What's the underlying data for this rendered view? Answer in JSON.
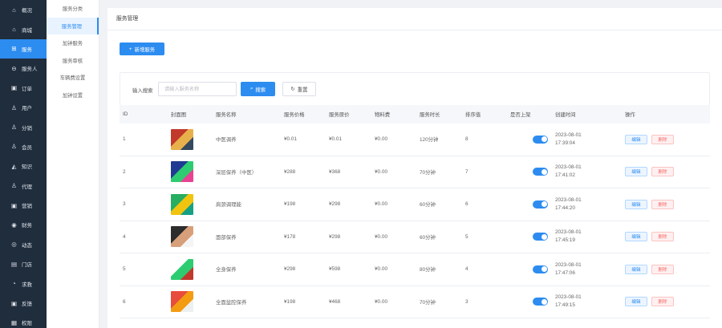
{
  "nav": {
    "items": [
      {
        "icon": "home-icon",
        "glyph": "⌂",
        "label": "概况"
      },
      {
        "icon": "shop-icon",
        "glyph": "⌂",
        "label": "商城"
      },
      {
        "icon": "service-icon",
        "glyph": "⊞",
        "label": "服务"
      },
      {
        "icon": "car-icon",
        "glyph": "⊖",
        "label": "服务人"
      },
      {
        "icon": "order-icon",
        "glyph": "▣",
        "label": "订单"
      },
      {
        "icon": "user-icon",
        "glyph": "♙",
        "label": "用户"
      },
      {
        "icon": "distribution-icon",
        "glyph": "♙",
        "label": "分销"
      },
      {
        "icon": "member-icon",
        "glyph": "♙",
        "label": "会员"
      },
      {
        "icon": "knowledge-icon",
        "glyph": "◭",
        "label": "知识"
      },
      {
        "icon": "agent-icon",
        "glyph": "♙",
        "label": "代理"
      },
      {
        "icon": "marketing-icon",
        "glyph": "▣",
        "label": "营销"
      },
      {
        "icon": "finance-icon",
        "glyph": "◉",
        "label": "财务"
      },
      {
        "icon": "activity-icon",
        "glyph": "◎",
        "label": "动态"
      },
      {
        "icon": "store-icon",
        "glyph": "▤",
        "label": "门店"
      },
      {
        "icon": "help-icon",
        "glyph": "◔",
        "label": "求救"
      },
      {
        "icon": "feedback-icon",
        "glyph": "▣",
        "label": "反馈"
      },
      {
        "icon": "permission-icon",
        "glyph": "▦",
        "label": "权限"
      }
    ],
    "active_index": 2
  },
  "subnav": {
    "items": [
      "服务分类",
      "服务管理",
      "加钟服务",
      "服务审核",
      "车辆费设置",
      "加钟设置"
    ],
    "active_index": 1
  },
  "page": {
    "title": "服务管理",
    "add_button": "新增服务"
  },
  "filter": {
    "label": "输入搜索",
    "placeholder": "请输入服务名称",
    "search_button": "搜索",
    "reset_button": "重置"
  },
  "table": {
    "columns": [
      "ID",
      "封面图",
      "服务名称",
      "服务价格",
      "服务原价",
      "物料费",
      "服务时长",
      "排序值",
      "是否上架",
      "创建时间",
      "操作"
    ],
    "edit_label": "编辑",
    "delete_label": "删除",
    "rows": [
      {
        "id": "1",
        "name": "中医调养",
        "price": "¥0.01",
        "orig": "¥0.01",
        "fee": "¥0.00",
        "duration": "120分钟",
        "sort": "8",
        "date": "2023-08-01",
        "time": "17:39:04",
        "colors": [
          "#c0392b",
          "#e8b04b",
          "#34495e"
        ]
      },
      {
        "id": "2",
        "name": "深层保养（中医）",
        "price": "¥288",
        "orig": "¥368",
        "fee": "¥0.00",
        "duration": "70分钟",
        "sort": "7",
        "date": "2023-08-01",
        "time": "17:41:02",
        "colors": [
          "#1f3a93",
          "#2ecc71",
          "#e84393"
        ]
      },
      {
        "id": "3",
        "name": "肩颈调理能",
        "price": "¥198",
        "orig": "¥298",
        "fee": "¥0.00",
        "duration": "60分钟",
        "sort": "6",
        "date": "2023-08-01",
        "time": "17:44:20",
        "colors": [
          "#27ae60",
          "#f1c40f",
          "#16a085"
        ]
      },
      {
        "id": "4",
        "name": "面部保养",
        "price": "¥178",
        "orig": "¥298",
        "fee": "¥0.00",
        "duration": "60分钟",
        "sort": "5",
        "date": "2023-08-01",
        "time": "17:45:19",
        "colors": [
          "#2c2c2c",
          "#d7a07b",
          "#f5f5f5"
        ]
      },
      {
        "id": "5",
        "name": "全身保养",
        "price": "¥298",
        "orig": "¥598",
        "fee": "¥0.00",
        "duration": "80分钟",
        "sort": "4",
        "date": "2023-08-01",
        "time": "17:47:06",
        "colors": [
          "#ffffff",
          "#2ecc71",
          "#c0392b"
        ]
      },
      {
        "id": "6",
        "name": "全面盆腔保养",
        "price": "¥198",
        "orig": "¥468",
        "fee": "¥0.00",
        "duration": "70分钟",
        "sort": "3",
        "date": "2023-08-01",
        "time": "17:49:15",
        "colors": [
          "#e74c3c",
          "#f39c12",
          "#ecf0f1"
        ]
      }
    ]
  }
}
